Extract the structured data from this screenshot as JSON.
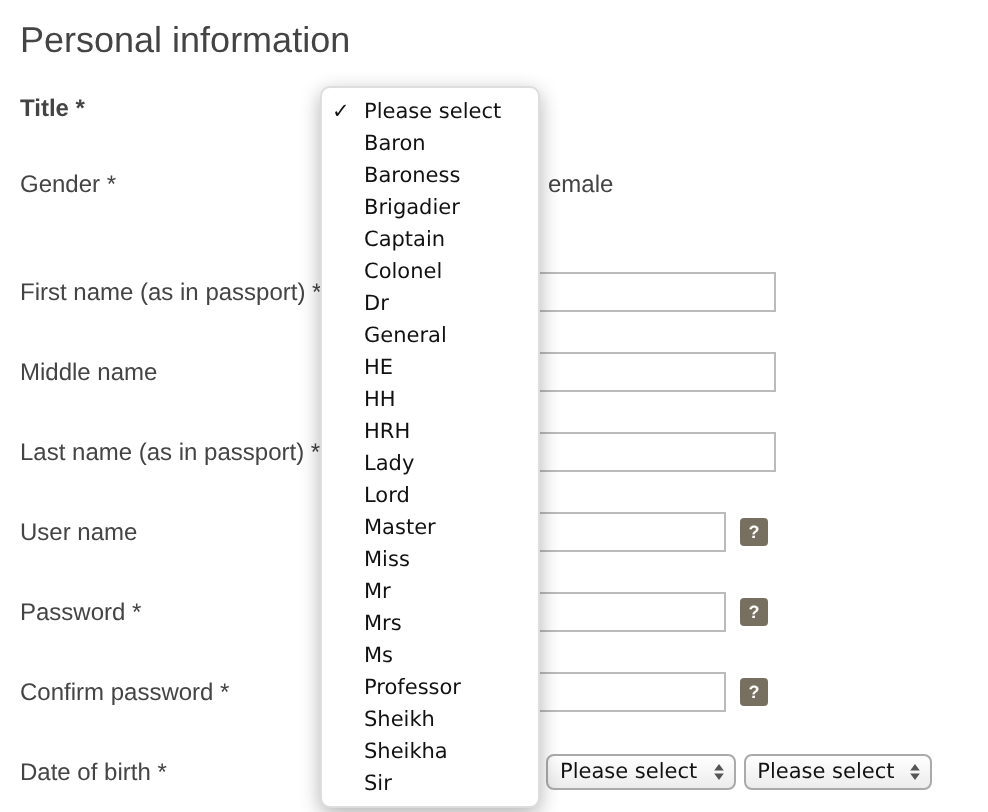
{
  "heading": "Personal information",
  "fields": [
    {
      "kind": "select",
      "label": "Title *"
    },
    {
      "kind": "radio",
      "label": "Gender *",
      "options": [
        {
          "label": "emale"
        }
      ]
    },
    {
      "kind": "text",
      "label": "First name (as in passport) *"
    },
    {
      "kind": "text",
      "label": "Middle name"
    },
    {
      "kind": "text",
      "label": "Last name (as in passport) *"
    },
    {
      "kind": "text",
      "label": "User name",
      "help": "?"
    },
    {
      "kind": "text",
      "label": "Password *",
      "help": "?"
    },
    {
      "kind": "text",
      "label": "Confirm password *",
      "help": "?"
    },
    {
      "kind": "date",
      "label": "Date of birth *",
      "selects": [
        "Please select",
        "Please select"
      ]
    }
  ],
  "title_menu": {
    "check": "✓",
    "items": [
      {
        "label": "Please select",
        "selected": true
      },
      {
        "label": "Baron",
        "selected": false
      },
      {
        "label": "Baroness",
        "selected": false
      },
      {
        "label": "Brigadier",
        "selected": false
      },
      {
        "label": "Captain",
        "selected": false
      },
      {
        "label": "Colonel",
        "selected": false
      },
      {
        "label": "Dr",
        "selected": false
      },
      {
        "label": "General",
        "selected": false
      },
      {
        "label": "HE",
        "selected": false
      },
      {
        "label": "HH",
        "selected": false
      },
      {
        "label": "HRH",
        "selected": false
      },
      {
        "label": "Lady",
        "selected": false
      },
      {
        "label": "Lord",
        "selected": false
      },
      {
        "label": "Master",
        "selected": false
      },
      {
        "label": "Miss",
        "selected": false
      },
      {
        "label": "Mr",
        "selected": false
      },
      {
        "label": "Mrs",
        "selected": false
      },
      {
        "label": "Ms",
        "selected": false
      },
      {
        "label": "Professor",
        "selected": false
      },
      {
        "label": "Sheikh",
        "selected": false
      },
      {
        "label": "Sheikha",
        "selected": false
      },
      {
        "label": "Sir",
        "selected": false
      }
    ]
  }
}
